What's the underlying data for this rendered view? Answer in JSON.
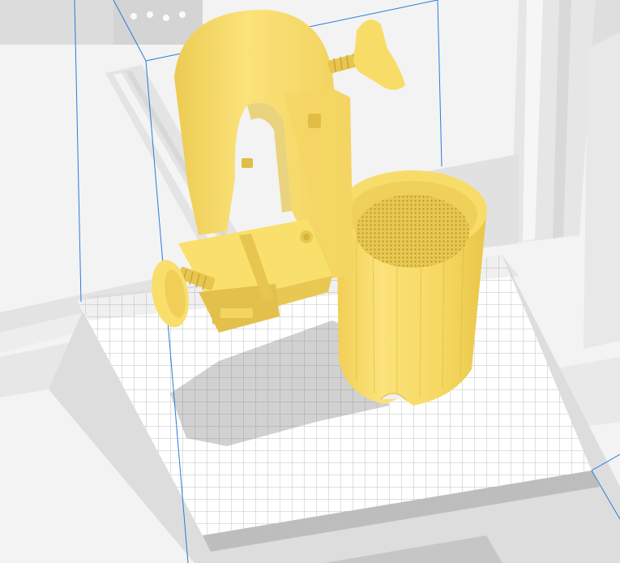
{
  "view": {
    "background_color": "#f3f3f3",
    "model_color": "#f9e06a",
    "model_shade_color": "#e8c94a",
    "build_volume_color": "#2a7bd8",
    "grid_color": "#b7b7b7",
    "grid_visible": true,
    "build_volume_visible": true
  },
  "model": {
    "parts": [
      "clamp-arch",
      "thumb-screw-top",
      "thumb-screw-side",
      "clamp-base-block",
      "cup-holder"
    ]
  },
  "printer": {
    "parts": [
      "frame-extrusion-left",
      "frame-extrusion-right",
      "frame-top-plate",
      "build-plate"
    ]
  }
}
